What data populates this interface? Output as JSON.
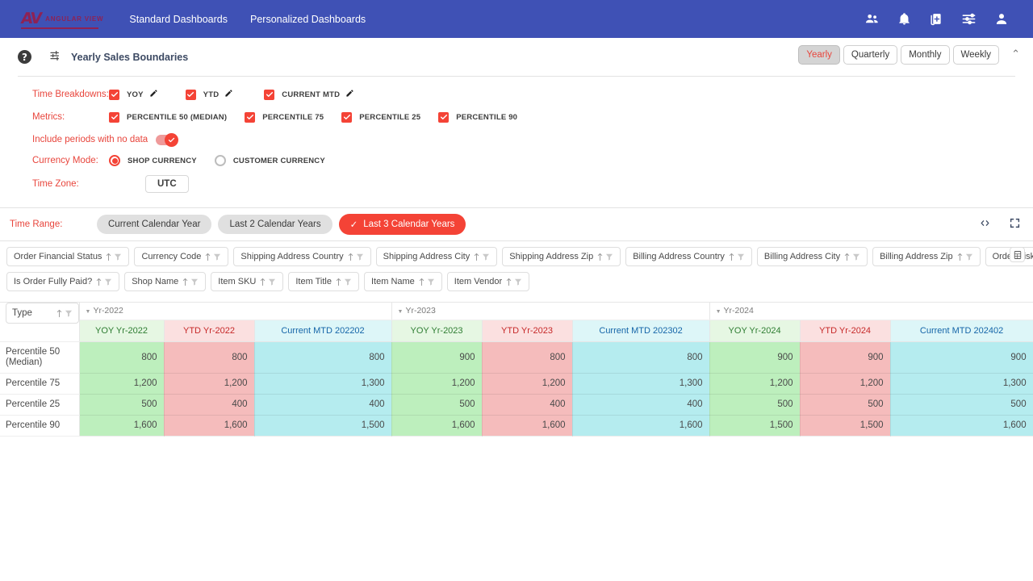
{
  "navbar": {
    "logo_mark": "AV",
    "logo_text": "ANGULAR VIEW",
    "links": [
      {
        "label": "Standard Dashboards"
      },
      {
        "label": "Personalized Dashboards"
      }
    ],
    "icons": [
      "people-icon",
      "bell-icon",
      "copy-add-icon",
      "sliders-icon",
      "account-icon"
    ]
  },
  "titlebar": {
    "help_label": "?",
    "title": "Yearly Sales Boundaries",
    "periods": [
      {
        "label": "Yearly",
        "active": true
      },
      {
        "label": "Quarterly",
        "active": false
      },
      {
        "label": "Monthly",
        "active": false
      },
      {
        "label": "Weekly",
        "active": false
      }
    ],
    "collapse_caret": "⌃"
  },
  "controls": {
    "time_breakdowns_label": "Time Breakdowns:",
    "time_breakdowns": [
      {
        "label": "YOY",
        "checked": true,
        "editable": true
      },
      {
        "label": "YTD",
        "checked": true,
        "editable": true
      },
      {
        "label": "CURRENT MTD",
        "checked": true,
        "editable": true
      }
    ],
    "metrics_label": "Metrics:",
    "metrics": [
      {
        "label": "PERCENTILE 50 (MEDIAN)",
        "checked": true
      },
      {
        "label": "PERCENTILE 75",
        "checked": true
      },
      {
        "label": "PERCENTILE 25",
        "checked": true
      },
      {
        "label": "PERCENTILE 90",
        "checked": true
      }
    ],
    "include_no_data_label": "Include periods with no data",
    "include_no_data_on": true,
    "currency_mode_label": "Currency Mode:",
    "currency_modes": [
      {
        "label": "SHOP CURRENCY",
        "selected": true
      },
      {
        "label": "CUSTOMER CURRENCY",
        "selected": false
      }
    ],
    "timezone_label": "Time Zone:",
    "timezone_value": "UTC"
  },
  "time_range": {
    "label": "Time Range:",
    "options": [
      {
        "label": "Current Calendar Year",
        "selected": false
      },
      {
        "label": "Last 2 Calendar Years",
        "selected": false
      },
      {
        "label": "Last 3 Calendar Years",
        "selected": true
      }
    ],
    "check_glyph": "✓",
    "icons": [
      "code-brackets-icon",
      "fullscreen-icon"
    ]
  },
  "filters": {
    "row1": [
      "Order Financial Status",
      "Currency Code",
      "Shipping Address Country",
      "Shipping Address City",
      "Shipping Address Zip",
      "Billing Address Country",
      "Billing Address City",
      "Billing Address Zip",
      "Order Risk Level"
    ],
    "row2": [
      "Is Order Fully Paid?",
      "Shop Name",
      "Item SKU",
      "Item Title",
      "Item Name",
      "Item Vendor"
    ],
    "export_icon": "spreadsheet-export-icon"
  },
  "table": {
    "type_column_label": "Type",
    "groups": [
      {
        "label": "Yr-2022"
      },
      {
        "label": "Yr-2023"
      },
      {
        "label": "Yr-2024"
      }
    ],
    "columns": [
      {
        "label": "YOY Yr-2022",
        "tone": "green"
      },
      {
        "label": "YTD Yr-2022",
        "tone": "pink"
      },
      {
        "label": "Current MTD 202202",
        "tone": "cyan"
      },
      {
        "label": "YOY Yr-2023",
        "tone": "green"
      },
      {
        "label": "YTD Yr-2023",
        "tone": "pink"
      },
      {
        "label": "Current MTD 202302",
        "tone": "cyan"
      },
      {
        "label": "YOY Yr-2024",
        "tone": "green"
      },
      {
        "label": "YTD Yr-2024",
        "tone": "pink"
      },
      {
        "label": "Current MTD 202402",
        "tone": "cyan"
      }
    ],
    "rows": [
      {
        "label": "Percentile 50 (Median)",
        "values": [
          "800",
          "800",
          "800",
          "900",
          "800",
          "800",
          "900",
          "900",
          "900"
        ]
      },
      {
        "label": "Percentile 75",
        "values": [
          "1,200",
          "1,200",
          "1,300",
          "1,200",
          "1,200",
          "1,300",
          "1,200",
          "1,200",
          "1,300"
        ]
      },
      {
        "label": "Percentile 25",
        "values": [
          "500",
          "400",
          "400",
          "500",
          "400",
          "400",
          "500",
          "500",
          "500"
        ]
      },
      {
        "label": "Percentile 90",
        "values": [
          "1,600",
          "1,600",
          "1,500",
          "1,600",
          "1,600",
          "1,600",
          "1,500",
          "1,500",
          "1,600"
        ]
      }
    ]
  },
  "colors": {
    "navbar": "#3f51b5",
    "accent_red": "#f44336",
    "logo": "#8e2255",
    "cell_green": "#bdefbd",
    "cell_pink": "#f5bcbc",
    "cell_cyan": "#b5ecef"
  }
}
